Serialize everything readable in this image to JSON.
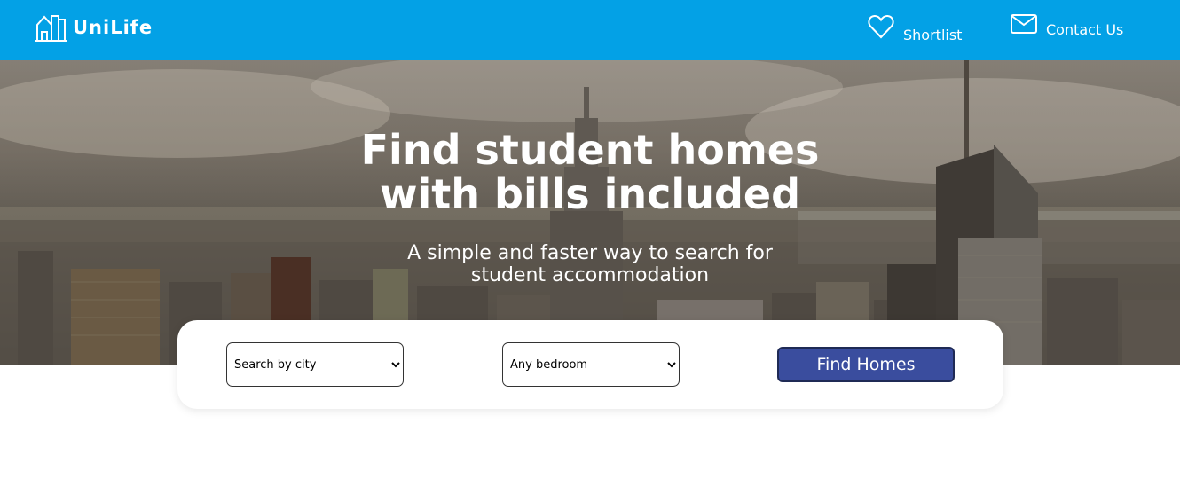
{
  "brand": {
    "name": "UniLife",
    "color": "#03a1e6"
  },
  "nav": {
    "shortlist": {
      "label": "Shortlist",
      "icon": "heart-icon"
    },
    "contact": {
      "label": "Contact Us",
      "icon": "envelope-icon"
    }
  },
  "hero": {
    "title_line1": "Find student homes",
    "title_line2": "with bills included",
    "subtitle_line1": "A simple and faster way to search for",
    "subtitle_line2": "student accommodation"
  },
  "search": {
    "city_selected": "Search by city",
    "bedroom_selected": "Any bedroom",
    "button_label": "Find Homes",
    "button_color": "#3a4d9e"
  }
}
